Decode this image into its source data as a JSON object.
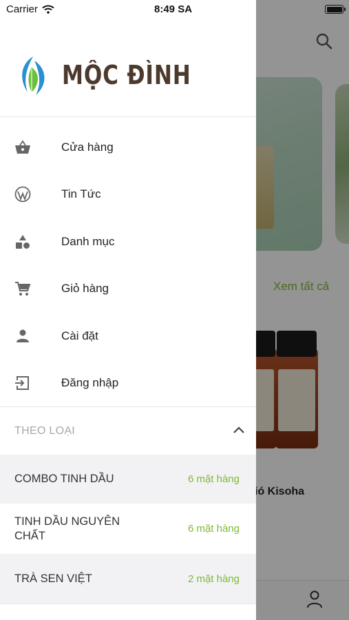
{
  "status_bar": {
    "carrier": "Carrier",
    "time": "8:49 SA"
  },
  "brand": {
    "name": "MỘC ĐÌNH",
    "colors": {
      "primary": "#4c3a2e",
      "leaf_blue": "#2b8fd4",
      "leaf_green": "#6cbf3c"
    }
  },
  "menu": [
    {
      "label": "Cửa hàng",
      "icon": "basket-icon"
    },
    {
      "label": "Tin Tức",
      "icon": "wordpress-icon"
    },
    {
      "label": "Danh mục",
      "icon": "category-shapes-icon"
    },
    {
      "label": "Giỏ hàng",
      "icon": "cart-icon"
    },
    {
      "label": "Cài đặt",
      "icon": "person-icon"
    },
    {
      "label": "Đăng nhập",
      "icon": "login-icon"
    }
  ],
  "categories_section": {
    "title": "THEO LOẠI",
    "expanded": true,
    "items": [
      {
        "name": "COMBO TINH DẦU",
        "count": "6 mặt hàng"
      },
      {
        "name": "TINH DẦU NGUYÊN CHẤT",
        "count": "6 mặt hàng"
      },
      {
        "name": "TRÀ SEN VIỆT",
        "count": "2 mặt hàng"
      }
    ]
  },
  "background": {
    "see_all": "Xem tất cả",
    "product_name": "àm Gió Kisoha",
    "accent_color": "#7cba36"
  }
}
